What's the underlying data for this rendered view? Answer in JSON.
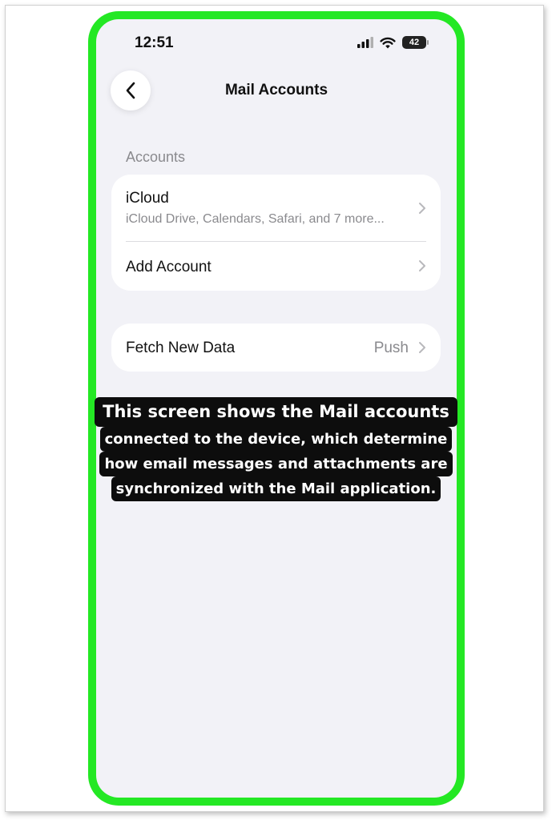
{
  "status_bar": {
    "time": "12:51",
    "battery_level": "42",
    "icons": [
      "cellular-signal-icon",
      "wifi-icon",
      "battery-icon"
    ]
  },
  "nav": {
    "back_icon": "chevron-left-icon",
    "title": "Mail Accounts"
  },
  "accounts_section": {
    "header": "Accounts",
    "items": [
      {
        "title": "iCloud",
        "subtitle": "iCloud Drive, Calendars, Safari, and 7 more..."
      },
      {
        "title": "Add Account"
      }
    ]
  },
  "fetch_section": {
    "title": "Fetch New Data",
    "value": "Push"
  },
  "caption": {
    "lines": [
      "This screen shows the Mail accounts",
      "connected to the device, which determine",
      "how email messages and attachments are",
      "synchronized with the Mail application."
    ]
  },
  "colors": {
    "phone_frame": "#24e824",
    "screen_background": "#f2f2f7",
    "secondary_text": "#8a8a8e",
    "caption_background": "#0d0d0d"
  }
}
